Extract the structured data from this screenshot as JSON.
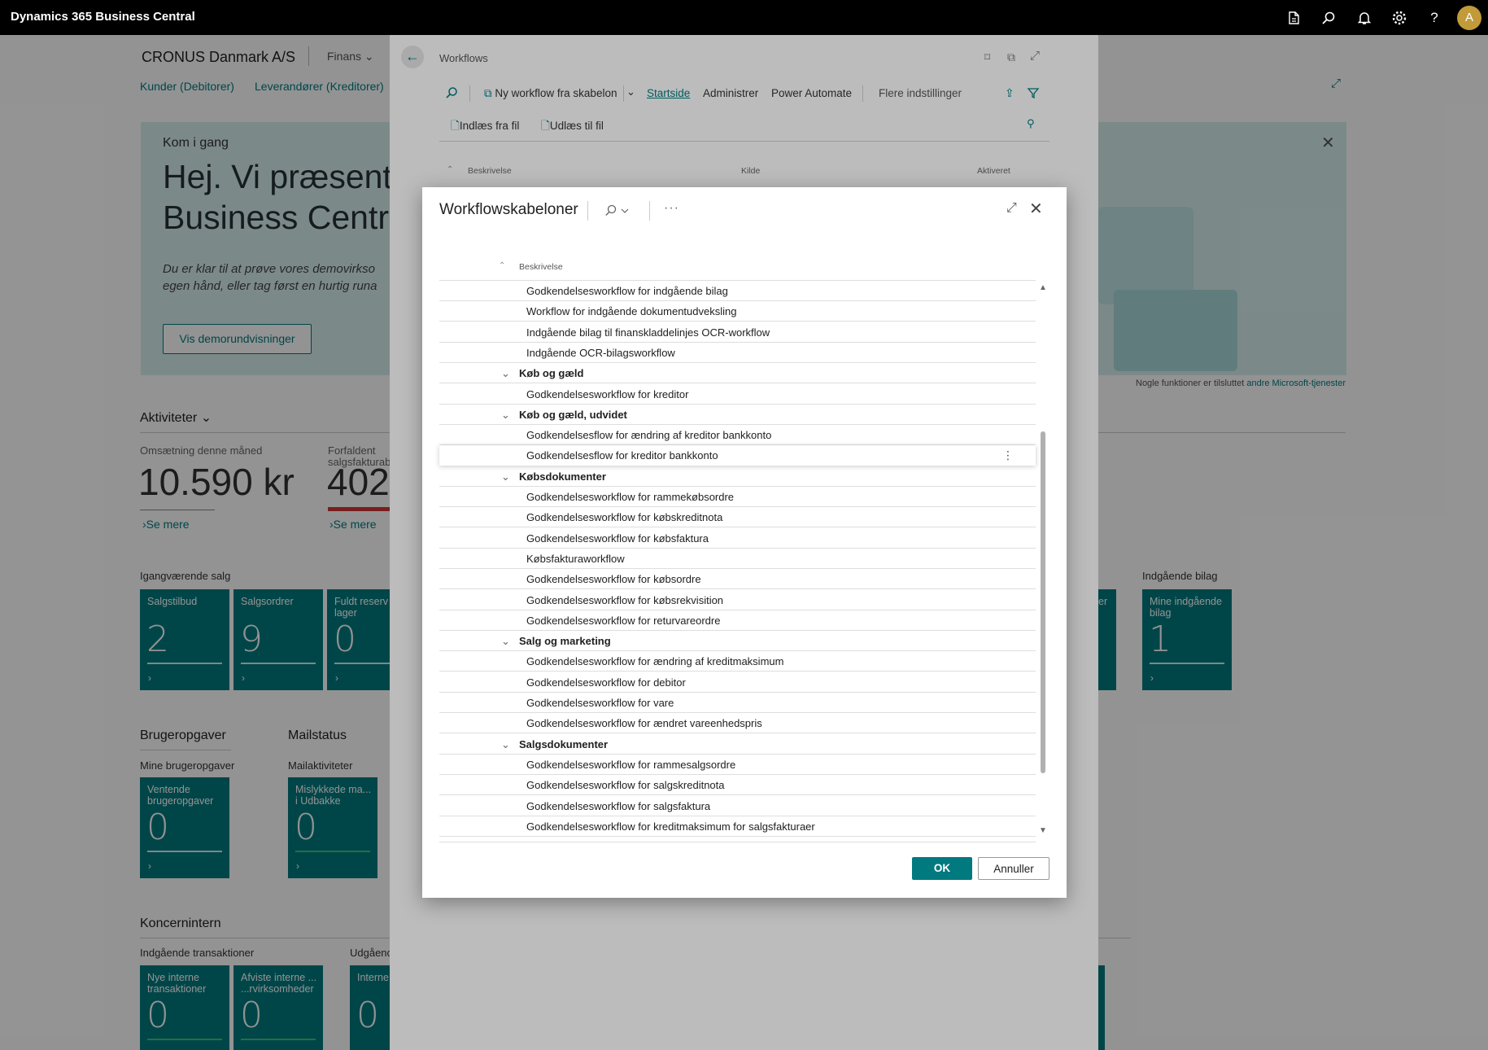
{
  "app": {
    "title": "Dynamics 365 Business Central"
  },
  "topbar_icons": [
    "document-icon",
    "search-icon",
    "bell-icon",
    "gear-icon",
    "help-icon"
  ],
  "user": {
    "initial": "A"
  },
  "role_center": {
    "company": "CRONUS Danmark A/S",
    "menu": "Finans",
    "nav": [
      "Kunder (Debitorer)",
      "Leverandører (Kreditorer)"
    ],
    "banner": {
      "eyebrow": "Kom i gang",
      "heading_line1": "Hej. Vi præsent",
      "heading_line2": "Business Centra",
      "body_line1": "Du er klar til at prøve vores demovirkso",
      "body_line2": "egen hånd, eller tag først en hurtig runa",
      "button": "Vis demorundvisninger",
      "footnote": "Nogle funktioner er tilsluttet",
      "footnote_link": "andre Microsoft-tjenester"
    },
    "activities": {
      "title": "Aktiviteter",
      "kpi1_label": "Omsætning denne måned",
      "kpi1_value": "10.590 kr",
      "kpi1_link": "Se mere",
      "kpi2_label": "Forfaldent",
      "kpi2_label2": "salgsfakturab",
      "kpi2_value": "402.",
      "kpi2_link": "Se mere"
    },
    "ongoing_sales": {
      "title": "Igangværende salg",
      "tiles": [
        {
          "label": "Salgstilbud",
          "value": "2"
        },
        {
          "label": "Salgsordrer",
          "value": "9"
        },
        {
          "label": "Fuldt reserv fra lager",
          "value": "0"
        }
      ]
    },
    "incoming_docs": {
      "title": "Indgående bilag",
      "tile": {
        "label": "Mine indgående bilag",
        "value": "1"
      },
      "partial_label": "er"
    },
    "user_tasks": {
      "title": "Brugeropgaver",
      "subtitle": "Mine brugeropgaver",
      "tile": {
        "label": "Ventende brugeropgaver",
        "value": "0"
      }
    },
    "mail": {
      "title": "Mailstatus",
      "subtitle": "Mailaktiviteter",
      "tile": {
        "label": "Mislykkede ma... i Udbakke",
        "value": "0"
      }
    },
    "intercompany": {
      "title": "Koncernintern",
      "subtitle": "Indgående transaktioner",
      "subtitle2": "Udgåenc",
      "tiles": [
        {
          "label": "Nye interne transaktioner",
          "value": "0"
        },
        {
          "label": "Afviste interne ... ...rvirksomheder",
          "value": "0"
        },
        {
          "label": "Interne til afsen",
          "value": "0"
        }
      ]
    }
  },
  "workflows_page": {
    "title": "Workflows",
    "actions": {
      "new_from_template": "Ny workflow fra skabelon",
      "home": "Startside",
      "manage": "Administrer",
      "power_automate": "Power Automate",
      "more": "Flere indstillinger",
      "import": "Indlæs fra fil",
      "export": "Udlæs til fil"
    },
    "columns": [
      "Beskrivelse",
      "Kilde",
      "Aktiveret"
    ]
  },
  "dialog": {
    "title": "Workflowskabeloner",
    "column": "Beskrivelse",
    "ok": "OK",
    "cancel": "Annuller",
    "rows": [
      {
        "type": "item",
        "text": "Godkendelsesworkflow for indgående bilag"
      },
      {
        "type": "item",
        "text": "Workflow for indgående dokumentudveksling"
      },
      {
        "type": "item",
        "text": "Indgående bilag til finanskladdelinjes OCR-workflow"
      },
      {
        "type": "item",
        "text": "Indgående OCR-bilagsworkflow"
      },
      {
        "type": "group",
        "text": "Køb og gæld"
      },
      {
        "type": "item",
        "text": "Godkendelsesworkflow for kreditor"
      },
      {
        "type": "group",
        "text": "Køb og gæld, udvidet"
      },
      {
        "type": "item",
        "text": "Godkendelsesflow for ændring af kreditor bankkonto"
      },
      {
        "type": "item",
        "text": "Godkendelsesflow for kreditor bankkonto",
        "selected": true
      },
      {
        "type": "group",
        "text": "Købsdokumenter"
      },
      {
        "type": "item",
        "text": "Godkendelsesworkflow for rammekøbsordre"
      },
      {
        "type": "item",
        "text": "Godkendelsesworkflow for købskreditnota"
      },
      {
        "type": "item",
        "text": "Godkendelsesworkflow for købsfaktura"
      },
      {
        "type": "item",
        "text": "Købsfakturaworkflow"
      },
      {
        "type": "item",
        "text": "Godkendelsesworkflow for købsordre"
      },
      {
        "type": "item",
        "text": "Godkendelsesworkflow for købsrekvisition"
      },
      {
        "type": "item",
        "text": "Godkendelsesworkflow for returvareordre"
      },
      {
        "type": "group",
        "text": "Salg og marketing"
      },
      {
        "type": "item",
        "text": "Godkendelsesworkflow for ændring af kreditmaksimum"
      },
      {
        "type": "item",
        "text": "Godkendelsesworkflow for debitor"
      },
      {
        "type": "item",
        "text": "Godkendelsesworkflow for vare"
      },
      {
        "type": "item",
        "text": "Godkendelsesworkflow for ændret vareenhedspris"
      },
      {
        "type": "group",
        "text": "Salgsdokumenter"
      },
      {
        "type": "item",
        "text": "Godkendelsesworkflow for rammesalgsordre"
      },
      {
        "type": "item",
        "text": "Godkendelsesworkflow for salgskreditnota"
      },
      {
        "type": "item",
        "text": "Godkendelsesworkflow for salgsfaktura"
      },
      {
        "type": "item",
        "text": "Godkendelsesworkflow for kreditmaksimum for salgsfakturaer"
      }
    ]
  },
  "colors": {
    "accent": "#00797f",
    "topbar": "#000000",
    "danger_bar": "#d13438"
  }
}
